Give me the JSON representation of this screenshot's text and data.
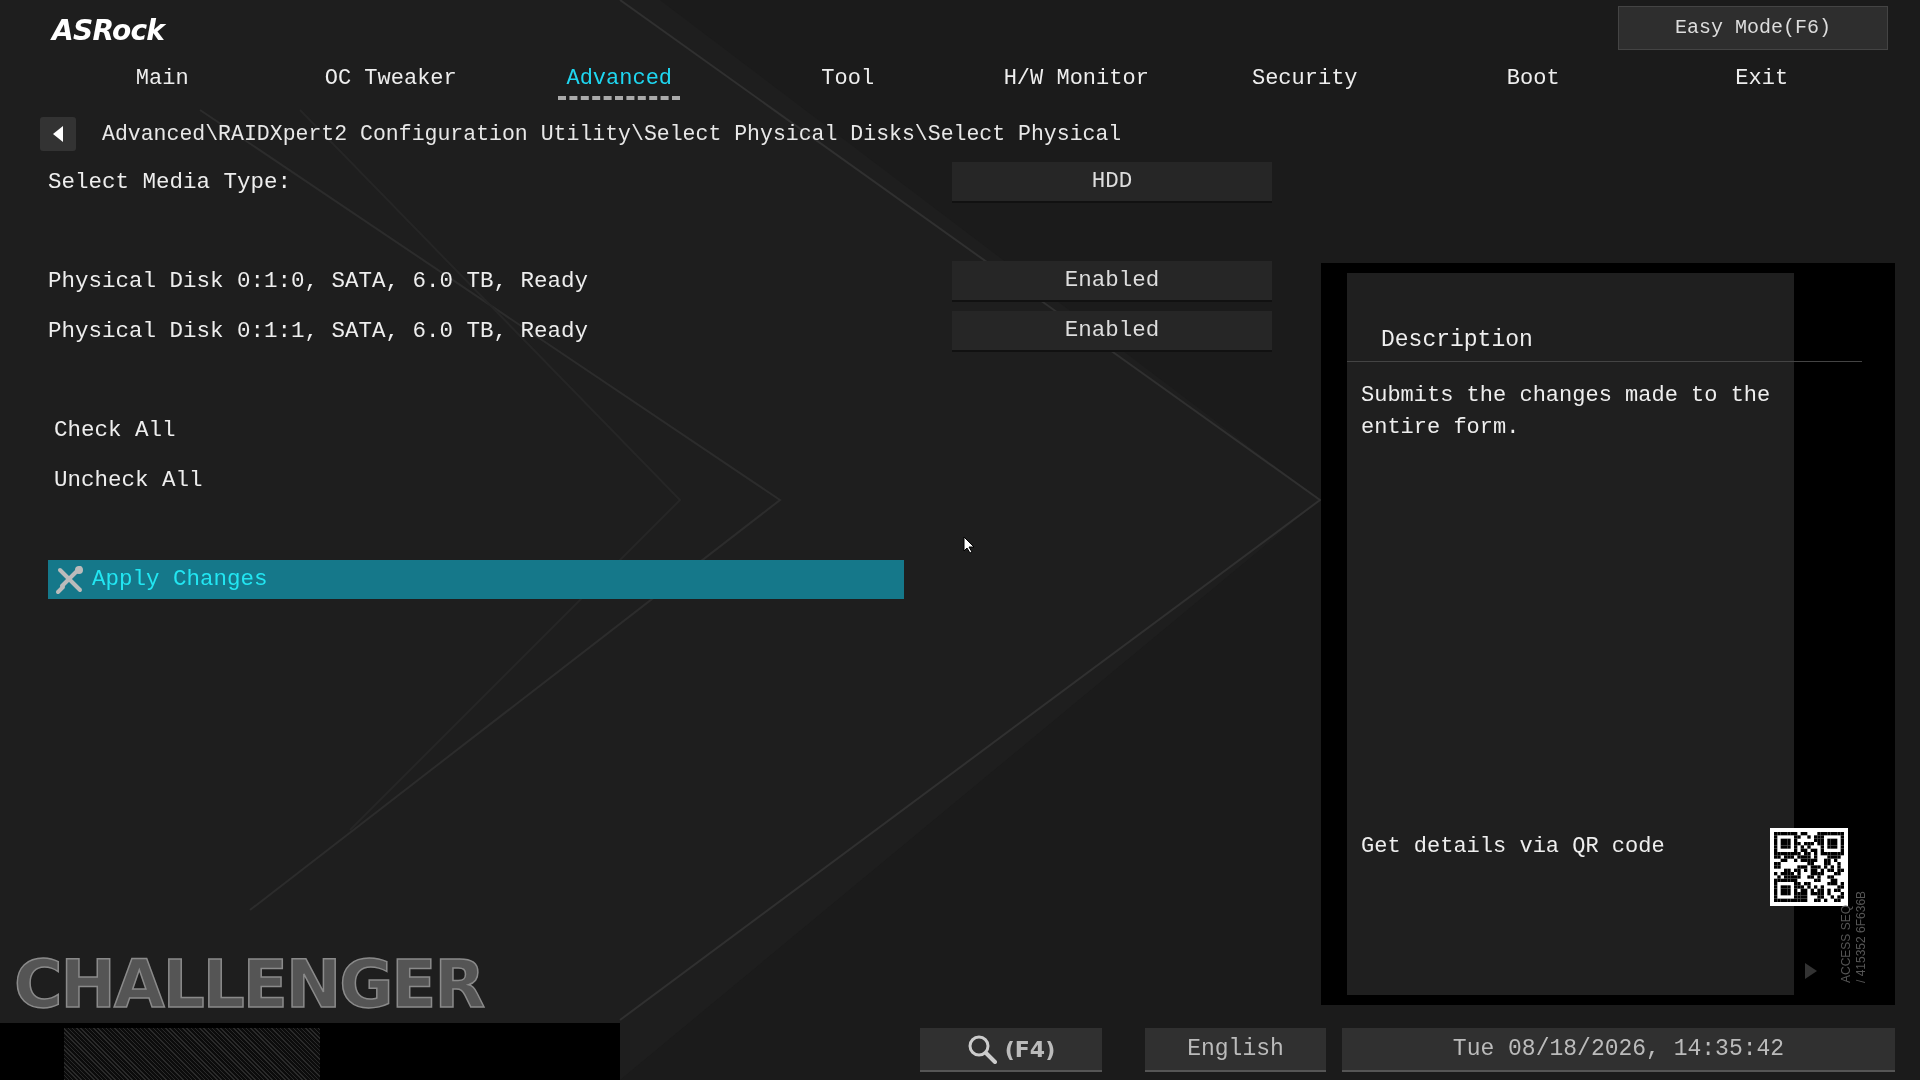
{
  "logo": "ASRock",
  "easy_mode_button": "Easy Mode(F6)",
  "tabs": [
    {
      "label": "Main",
      "selected": false
    },
    {
      "label": "OC Tweaker",
      "selected": false
    },
    {
      "label": "Advanced",
      "selected": true
    },
    {
      "label": "Tool",
      "selected": false
    },
    {
      "label": "H/W Monitor",
      "selected": false
    },
    {
      "label": "Security",
      "selected": false
    },
    {
      "label": "Boot",
      "selected": false
    },
    {
      "label": "Exit",
      "selected": false
    }
  ],
  "breadcrumb": "Advanced\\RAIDXpert2 Configuration Utility\\Select Physical Disks\\Select Physical",
  "setting_groups": [
    {
      "items": [
        {
          "kind": "option",
          "label": "Select Media Type:",
          "value": "HDD",
          "selected": false
        }
      ]
    },
    {
      "items": [
        {
          "kind": "option",
          "label": "Physical Disk 0:1:0, SATA, 6.0 TB, Ready",
          "value": "Enabled",
          "selected": false
        },
        {
          "kind": "option",
          "label": "Physical Disk 0:1:1, SATA, 6.0 TB, Ready",
          "value": "Enabled",
          "selected": false
        }
      ]
    },
    {
      "items": [
        {
          "kind": "action",
          "label": "Check All",
          "selected": false
        },
        {
          "kind": "action",
          "label": "Uncheck All",
          "selected": false
        }
      ]
    },
    {
      "items": [
        {
          "kind": "action",
          "label": "Apply Changes",
          "selected": true
        }
      ]
    }
  ],
  "description": {
    "title": "Description",
    "text": "Submits the changes made to the entire form.",
    "qr_label": "Get details via QR code",
    "access_lines": [
      "ACCESS SEQ",
      "/ 415352 6F636B"
    ]
  },
  "branding": "CHALLENGER",
  "status_bar": {
    "search_key": "(F4)",
    "language": "English",
    "datetime": "Tue 08/18/2026, 14:35:42"
  }
}
